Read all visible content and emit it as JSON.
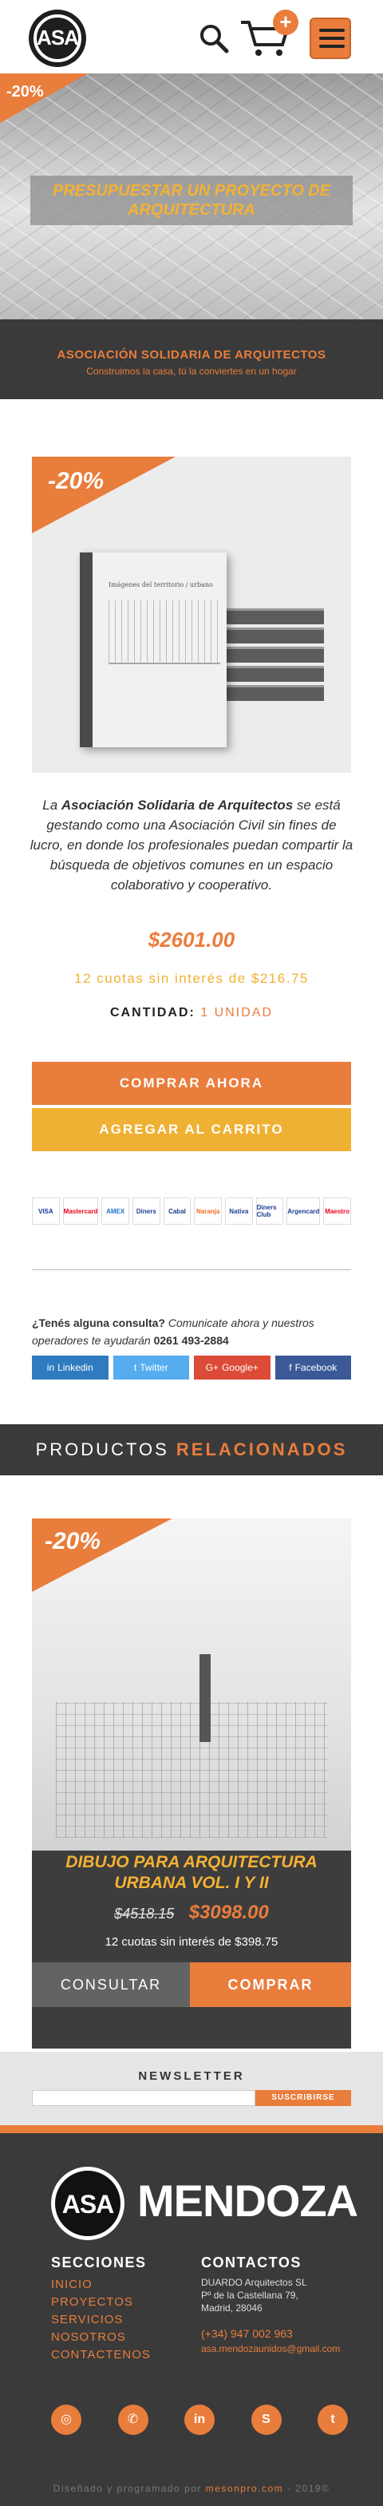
{
  "header": {
    "logo_text": "ASA",
    "cart_badge": "+",
    "colors": {
      "accent": "#e97d3c",
      "gold": "#f4b133",
      "dark": "#3a3a3a"
    }
  },
  "hero": {
    "discount": "-20%",
    "title": "PRESUPUESTAR UN PROYECTO DE ARQUITECTURA"
  },
  "association": {
    "name": "ASOCIACIÓN SOLIDARIA DE ARQUITECTOS",
    "tagline": "Construimos la casa, tú la conviertes en un hogar"
  },
  "product": {
    "discount": "-20%",
    "book_title": "Imágenes del territorio / urbano",
    "description_intro": "La ",
    "description_bold": "Asociación Solidaria de Arquitectos",
    "description_rest": " se está gestando como una Asociación Civil sin fines de lucro, en donde los profesionales puedan compartir la búsqueda de objetivos comunes en un espacio colaborativo y cooperativo.",
    "price": "$2601.00",
    "installments": "12 cuotas sin interés de $216.75",
    "quantity_label": "CANTIDAD:",
    "quantity_value": "1 UNIDAD",
    "buy_now": "COMPRAR AHORA",
    "add_to_cart": "AGREGAR AL CARRITO"
  },
  "payments": [
    "VISA",
    "Mastercard",
    "AMEX",
    "Diners",
    "Cabal",
    "Naranja",
    "Nativa",
    "Diners Club",
    "Argencard",
    "Maestro"
  ],
  "contact": {
    "question": "¿Tenés alguna consulta?",
    "invite": " Comunicate ahora y nuestros operadores te ayudarán ",
    "phone": "0261 493-2884"
  },
  "shares": [
    {
      "label": "Linkedin",
      "icon": "in",
      "color": "#2f7bbf"
    },
    {
      "label": "Twitter",
      "icon": "t",
      "color": "#55acee"
    },
    {
      "label": "Google+",
      "icon": "G+",
      "color": "#dc4a38"
    },
    {
      "label": "Facebook",
      "icon": "f",
      "color": "#3b5998"
    }
  ],
  "related": {
    "title_a": "PRODUCTOS",
    "title_b": "RELACIONADOS",
    "card": {
      "discount": "-20%",
      "title": "DIBUJO PARA ARQUITECTURA URBANA VOL. I y II",
      "old_price": "$4518.15",
      "new_price": "$3098.00",
      "installments": "12 cuotas sin interés de $398.75",
      "consult": "CONSULTAR",
      "buy": "COMPRAR"
    }
  },
  "newsletter": {
    "title": "NEWSLETTER",
    "placeholder": "",
    "button": "SUSCRIBIRSE"
  },
  "footer": {
    "logo_text": "ASA",
    "brand": "MENDOZA",
    "sections_title": "SECCIONES",
    "sections": [
      "INICIO",
      "PROYECTOS",
      "SERVICIOS",
      "NOSOTROS",
      "CONTACTENOS"
    ],
    "contacts_title": "CONTACTOS",
    "address": [
      "DUARDO Arquitectos SL",
      "Pº de la Castellana 79,",
      "Madrid, 28046"
    ],
    "phone": "(+34) 947 002 963",
    "email": "asa.mendozaunidos@gmail.com",
    "socials": [
      "instagram",
      "whatsapp",
      "linkedin",
      "skype",
      "twitter"
    ],
    "credit_a": "Diseñado y programado por ",
    "credit_b": "mesonpro.com",
    "credit_c": " - 2019©"
  }
}
